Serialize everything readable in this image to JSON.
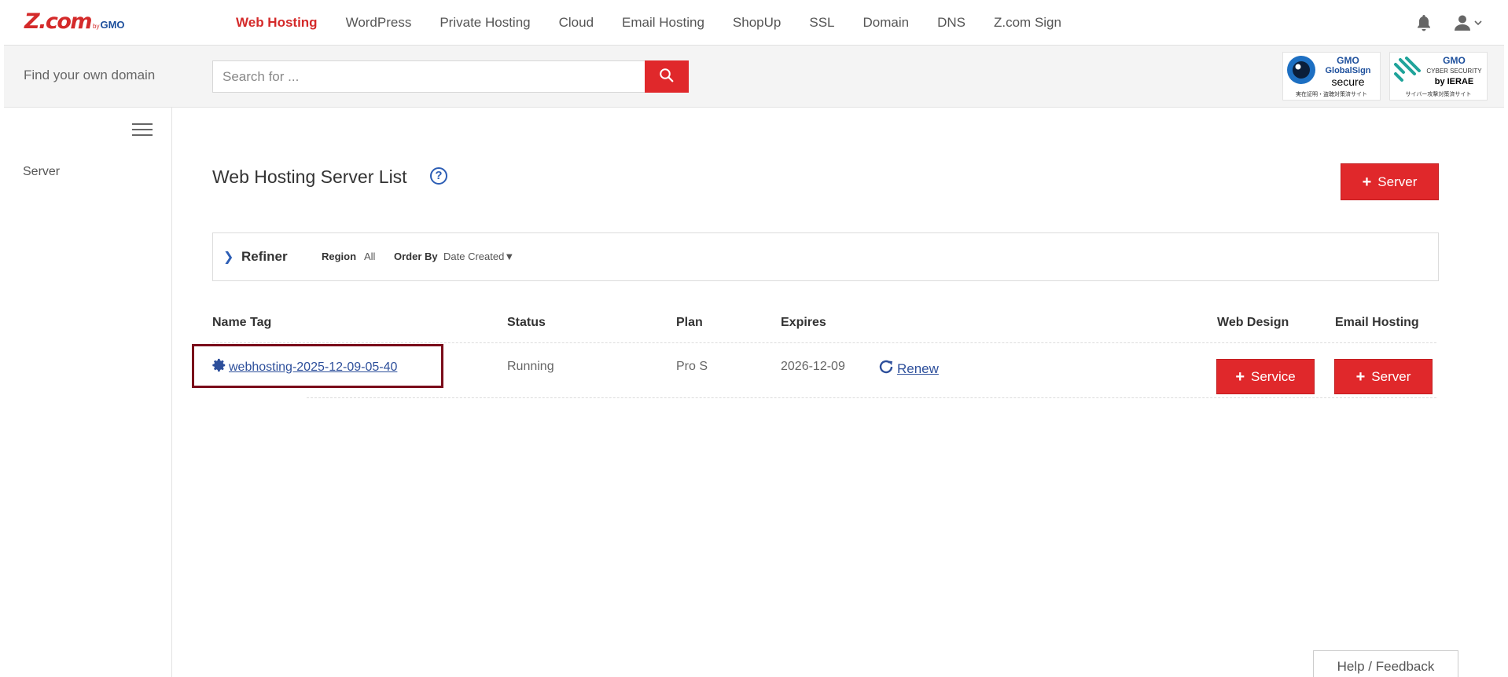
{
  "brand": {
    "logo_main": "Z.com",
    "logo_by": "by",
    "logo_gmo": "GMO",
    "accent_color": "#e0282b",
    "link_color": "#2d4f9b"
  },
  "nav": {
    "items": [
      {
        "label": "Web Hosting",
        "active": true
      },
      {
        "label": "WordPress"
      },
      {
        "label": "Private Hosting"
      },
      {
        "label": "Cloud"
      },
      {
        "label": "Email Hosting"
      },
      {
        "label": "ShopUp"
      },
      {
        "label": "SSL"
      },
      {
        "label": "Domain"
      },
      {
        "label": "DNS"
      },
      {
        "label": "Z.com Sign"
      }
    ],
    "icons": [
      "bell-icon",
      "user-icon",
      "chevron-down-icon"
    ]
  },
  "search": {
    "label": "Find your own domain",
    "placeholder": "Search for ...",
    "button_icon": "search-icon"
  },
  "badges": {
    "globalsign": {
      "top": "GMO",
      "line1": "GlobalSign",
      "line2": "secure",
      "jp": "実在証明・盗聴対策済サイト"
    },
    "ierae": {
      "top": "GMO",
      "line1": "CYBER SECURITY",
      "line2": "by IERAE",
      "jp": "サイバー攻撃対策済サイト"
    }
  },
  "sidebar": {
    "items": [
      {
        "label": "Server"
      }
    ]
  },
  "main": {
    "title": "Web Hosting Server List",
    "add_server_label": "Server",
    "refiner": {
      "label": "Refiner",
      "region_key": "Region",
      "region_value": "All",
      "order_key": "Order By",
      "order_value": "Date Created▼"
    },
    "table": {
      "headers": {
        "name_tag": "Name Tag",
        "status": "Status",
        "plan": "Plan",
        "expires": "Expires",
        "web_design": "Web Design",
        "email_hosting": "Email Hosting"
      },
      "rows": [
        {
          "name_tag": "webhosting-2025-12-09-05-40",
          "status": "Running",
          "plan": "Pro S",
          "expires": "2026-12-09",
          "renew_label": "Renew",
          "web_design_button": "Service",
          "email_hosting_button": "Server"
        }
      ]
    }
  },
  "footer": {
    "help_feedback": "Help / Feedback"
  }
}
